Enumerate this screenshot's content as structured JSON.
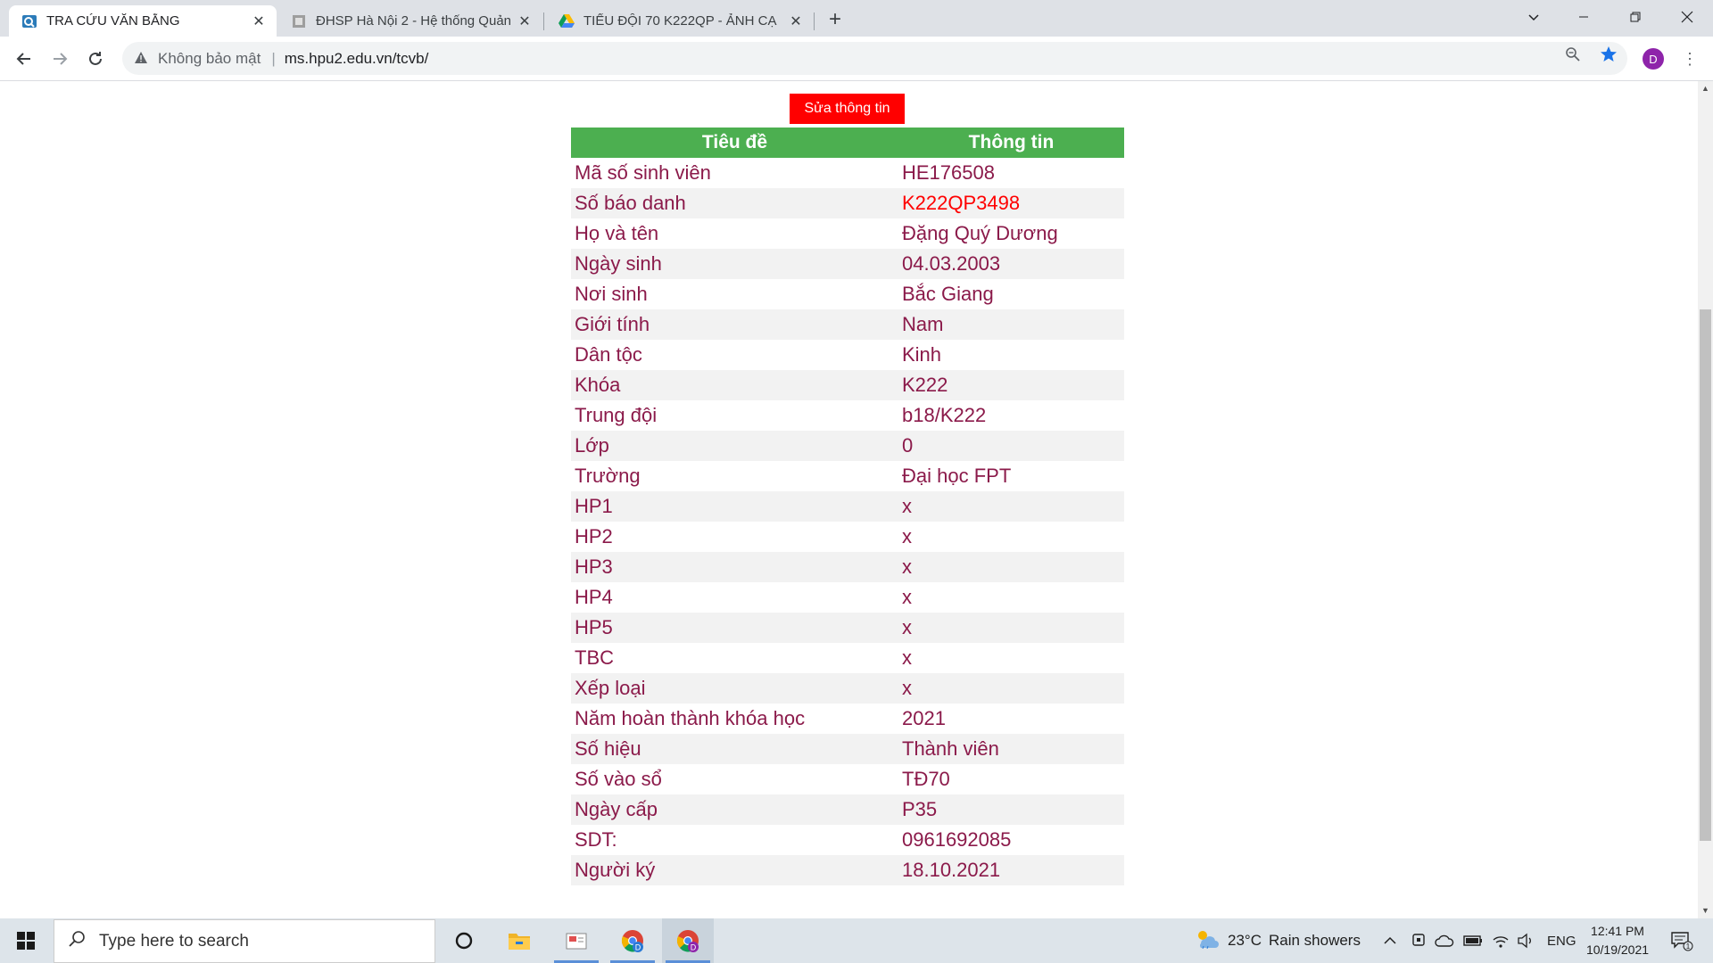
{
  "browser": {
    "tabs": [
      {
        "title": "TRA CỨU VĂN BẰNG",
        "active": true
      },
      {
        "title": "ĐHSP Hà Nội 2 - Hệ thống Quản",
        "active": false
      },
      {
        "title": "TIỂU ĐỘI 70 K222QP - ẢNH CẠ",
        "active": false
      }
    ],
    "address": {
      "security_label": "Không bảo mật",
      "url": "ms.hpu2.edu.vn/tcvb/"
    },
    "profile_initial": "D"
  },
  "page": {
    "edit_button_label": "Sửa thông tin",
    "table": {
      "headers": [
        "Tiêu đề",
        "Thông tin"
      ],
      "rows": [
        {
          "label": "Mã số sinh viên",
          "value": "HE176508"
        },
        {
          "label": "Số báo danh",
          "value": "K222QP3498",
          "highlight": true
        },
        {
          "label": "Họ và tên",
          "value": "Đặng Quý Dương"
        },
        {
          "label": "Ngày sinh",
          "value": "04.03.2003"
        },
        {
          "label": "Nơi sinh",
          "value": "Bắc Giang"
        },
        {
          "label": "Giới tính",
          "value": "Nam"
        },
        {
          "label": "Dân tộc",
          "value": "Kinh"
        },
        {
          "label": "Khóa",
          "value": "K222"
        },
        {
          "label": "Trung đội",
          "value": "b18/K222"
        },
        {
          "label": "Lớp",
          "value": "0"
        },
        {
          "label": "Trường",
          "value": "Đại học FPT"
        },
        {
          "label": "HP1",
          "value": "x"
        },
        {
          "label": "HP2",
          "value": "x"
        },
        {
          "label": "HP3",
          "value": "x"
        },
        {
          "label": "HP4",
          "value": "x"
        },
        {
          "label": "HP5",
          "value": "x"
        },
        {
          "label": "TBC",
          "value": "x"
        },
        {
          "label": "Xếp loại",
          "value": "x"
        },
        {
          "label": "Năm hoàn thành khóa học",
          "value": "2021"
        },
        {
          "label": "Số hiệu",
          "value": "Thành viên"
        },
        {
          "label": "Số vào sổ",
          "value": "TĐ70"
        },
        {
          "label": "Ngày cấp",
          "value": "P35"
        },
        {
          "label": "SDT:",
          "value": "0961692085"
        },
        {
          "label": "Người ký",
          "value": "18.10.2021"
        }
      ]
    }
  },
  "taskbar": {
    "search_placeholder": "Type here to search",
    "weather": {
      "temp": "23°C",
      "condition": "Rain showers"
    },
    "language": "ENG",
    "time": "12:41 PM",
    "date": "10/19/2021",
    "notification_count": "1"
  },
  "colors": {
    "header_green": "#4caf50",
    "edit_button_red": "#ff0000",
    "text_maroon": "#8b1a4a",
    "highlight_red": "#ff0000"
  }
}
